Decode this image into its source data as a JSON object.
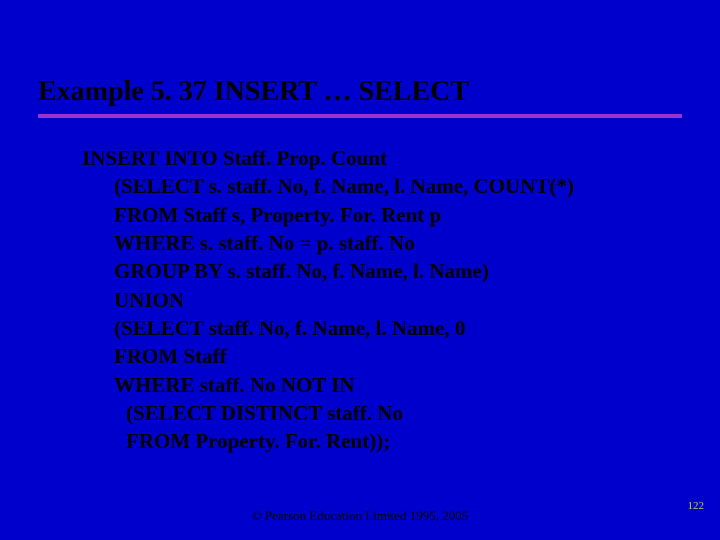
{
  "title": "Example 5. 37  INSERT … SELECT",
  "lines": {
    "l0": "INSERT INTO Staff. Prop. Count",
    "l1": "(SELECT s. staff. No, f. Name, l. Name, COUNT(*)",
    "l2": "FROM Staff s, Property. For. Rent p",
    "l3": "WHERE s. staff. No = p. staff. No",
    "l4": "GROUP BY s. staff. No, f. Name, l. Name)",
    "l5": "UNION",
    "l6": "(SELECT staff. No, f. Name, l. Name, 0",
    "l7": "FROM Staff",
    "l8": "WHERE staff. No NOT IN",
    "l9": "(SELECT DISTINCT staff. No",
    "l10": "FROM Property. For. Rent));"
  },
  "footer": "© Pearson Education Limited 1995, 2005",
  "page": "122"
}
